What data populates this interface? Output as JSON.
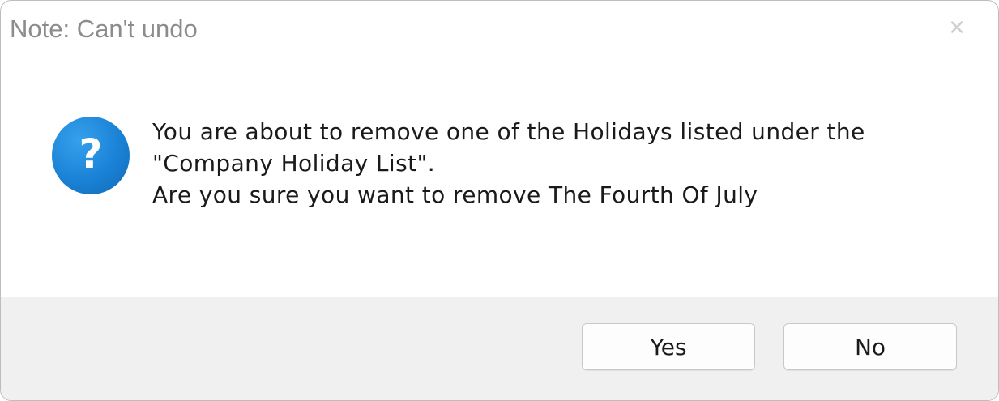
{
  "dialog": {
    "title": "Note: Can't undo",
    "close_icon": "close-icon",
    "icon": "question-icon",
    "icon_glyph": "?",
    "icon_color": "#1a82d6",
    "message_lines": [
      "You are about to remove one of the Holidays listed under the",
      "\"Company Holiday List\".",
      "Are you sure you want to remove The Fourth Of July"
    ],
    "buttons": {
      "yes_label": "Yes",
      "no_label": "No"
    }
  }
}
